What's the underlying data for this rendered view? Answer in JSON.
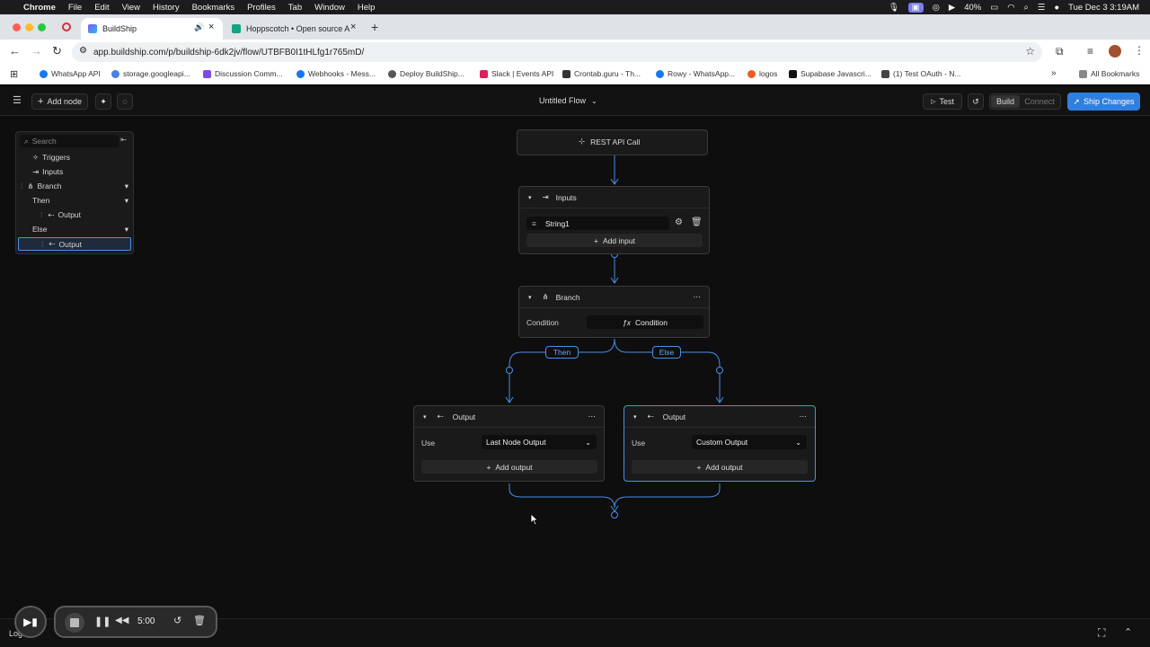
{
  "menubar": {
    "items": [
      "Chrome",
      "File",
      "Edit",
      "View",
      "History",
      "Bookmarks",
      "Profiles",
      "Tab",
      "Window",
      "Help"
    ],
    "battery": "40%",
    "clock": "Tue Dec 3  3:19AM"
  },
  "browser": {
    "tabs": [
      {
        "title": "BuildShip",
        "active": true
      },
      {
        "title": "Hoppscotch • Open source A",
        "active": false
      }
    ],
    "url": "app.buildship.com/p/buildship-6dk2jv/flow/UTBFB0I1tHLfg1r765mD/",
    "bookmarks": [
      "WhatsApp API",
      "storage.googleapi...",
      "Discussion Comm...",
      "Webhooks - Mess...",
      "Deploy BuildShip...",
      "Slack | Events API",
      "Crontab.guru - Th...",
      "Rowy - WhatsApp...",
      "logos",
      "Supabase Javascri...",
      "(1) Test OAuth - N..."
    ],
    "all_bookmarks": "All Bookmarks"
  },
  "toolbar": {
    "add_node": "Add node",
    "flow_title": "Untitled Flow",
    "test": "Test",
    "build": "Build",
    "connect": "Connect",
    "ship": "Ship Changes"
  },
  "tree": {
    "search_placeholder": "Search",
    "triggers": "Triggers",
    "inputs": "Inputs",
    "branch": "Branch",
    "then": "Then",
    "then_output": "Output",
    "else": "Else",
    "else_output": "Output"
  },
  "flow": {
    "trigger": "REST API Call",
    "inputs_title": "Inputs",
    "input_name": "String1",
    "add_input": "Add input",
    "branch_title": "Branch",
    "condition_label": "Condition",
    "condition_value": "Condition",
    "then_label": "Then",
    "else_label": "Else",
    "output_left": {
      "title": "Output",
      "use_label": "Use",
      "use_value": "Last Node Output",
      "add": "Add output"
    },
    "output_right": {
      "title": "Output",
      "use_label": "Use",
      "use_value": "Custom Output",
      "add": "Add output"
    }
  },
  "recorder": {
    "time": "5:00"
  },
  "bottom": {
    "logs": "Log"
  },
  "colors": {
    "accent": "#2f7fe0",
    "edge": "#4b8fe8"
  }
}
